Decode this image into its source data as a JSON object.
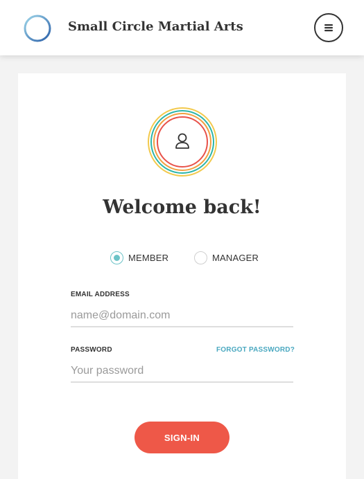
{
  "header": {
    "brand": "Small Circle Martial Arts",
    "logo_icon": "ring-logo-icon",
    "menu_icon": "hamburger-menu-icon"
  },
  "login": {
    "avatar_icon": "user-icon",
    "title": "Welcome back!",
    "roles": [
      {
        "label": "MEMBER",
        "selected": true
      },
      {
        "label": "MANAGER",
        "selected": false
      }
    ],
    "email": {
      "label": "EMAIL ADDRESS",
      "value": "",
      "placeholder": "name@domain.com"
    },
    "password": {
      "label": "PASSWORD",
      "value": "",
      "placeholder": "Your password"
    },
    "forgot_label": "FORGOT PASSWORD?",
    "submit_label": "SIGN-IN"
  },
  "colors": {
    "accent": "#ee5848",
    "link": "#4aa8c0",
    "radio": "#6cc3c7",
    "ring_yellow": "#f2c94c",
    "ring_teal": "#2bb5a8",
    "ring_orange": "#f0a040",
    "ring_red": "#e8524a"
  }
}
